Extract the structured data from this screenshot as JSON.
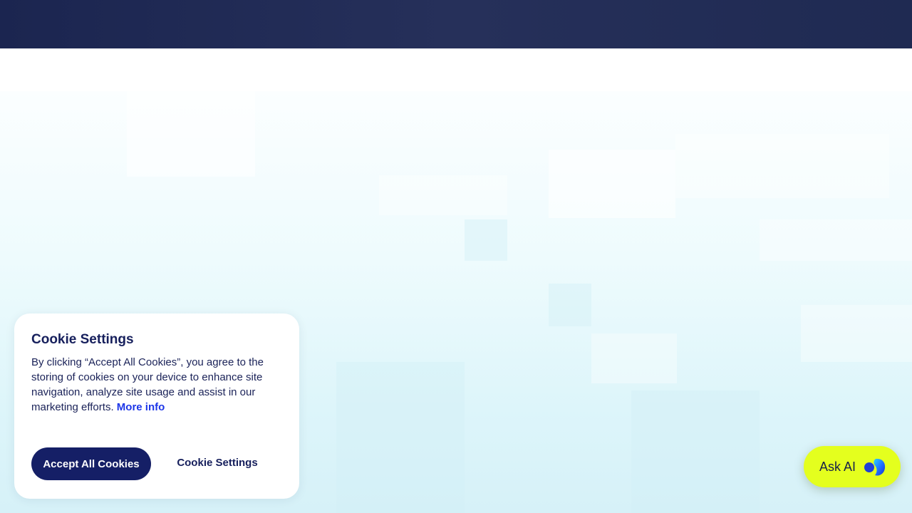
{
  "cookie_banner": {
    "title": "Cookie Settings",
    "body_text": "By clicking “Accept All Cookies”, you agree to the storing of cookies on your device to enhance site navigation, analyze site usage and assist in our marketing efforts.",
    "more_info_link": "More info",
    "accept_button": "Accept All Cookies",
    "settings_button": "Cookie Settings"
  },
  "ask_ai": {
    "label": "Ask AI",
    "icon": "ai-assistant-logo-icon"
  },
  "colors": {
    "header_bg": "#1f2a52",
    "accent_navy": "#151f66",
    "link_blue": "#1d36e8",
    "ask_ai_bg": "#e4ff1e"
  }
}
